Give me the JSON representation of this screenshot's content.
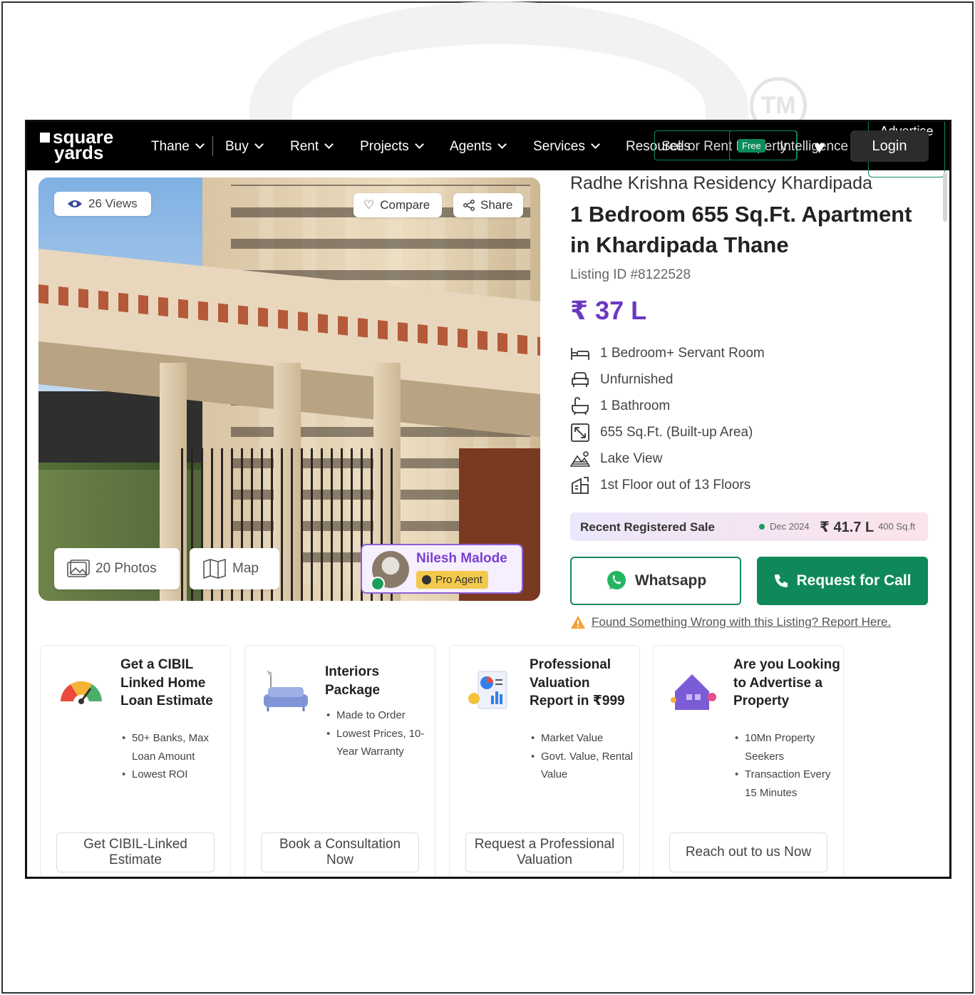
{
  "nav": {
    "logo_line1": "square",
    "logo_line2": "yards",
    "items": [
      {
        "label": "Thane"
      },
      {
        "label": "Buy"
      },
      {
        "label": "Rent"
      },
      {
        "label": "Projects"
      },
      {
        "label": "Agents"
      },
      {
        "label": "Services"
      }
    ],
    "resources_label": "Resources",
    "sell_rent_label": "Sell or Rent Property",
    "free_badge": "Free",
    "intelligence_label": "Intelligence",
    "login_label": "Login",
    "advertise_label": "Advertise with us"
  },
  "gallery": {
    "views": "26 Views",
    "compare_label": "Compare",
    "share_label": "Share",
    "photos_label": "20 Photos",
    "map_label": "Map",
    "agent_name": "Nilesh Malode",
    "agent_badge": "Pro Agent"
  },
  "listing": {
    "project_name": "Radhe Krishna Residency Khardipada",
    "title": "1 Bedroom 655 Sq.Ft. Apartment in Khardipada Thane",
    "listing_id": "Listing ID #8122528",
    "price": "₹ 37 L",
    "features": [
      {
        "icon": "bed-icon",
        "label": "1 Bedroom+ Servant Room"
      },
      {
        "icon": "sofa-icon",
        "label": "Unfurnished"
      },
      {
        "icon": "bathtub-icon",
        "label": "1 Bathroom"
      },
      {
        "icon": "area-icon",
        "label": "655 Sq.Ft. (Built-up Area)"
      },
      {
        "icon": "view-icon",
        "label": "Lake View"
      },
      {
        "icon": "floor-icon",
        "label": "1st Floor out of 13 Floors"
      }
    ],
    "recent_sale": {
      "label": "Recent Registered Sale",
      "date": "Dec 2024",
      "price": "₹ 41.7 L",
      "area": "400 Sq.ft"
    },
    "whatsapp_label": "Whatsapp",
    "call_label": "Request for Call",
    "report_text": "Found Something Wrong with this Listing? Report Here."
  },
  "cards": [
    {
      "icon": "gauge-icon",
      "title": "Get a CIBIL Linked Home Loan Estimate",
      "bullets": [
        "50+ Banks, Max Loan Amount",
        "Lowest ROI"
      ],
      "button": "Get CIBIL-Linked Estimate"
    },
    {
      "icon": "sofa-lamp-icon",
      "title": "Interiors Package",
      "bullets": [
        "Made to Order",
        "Lowest Prices, 10-Year Warranty"
      ],
      "button": "Book a Consultation Now"
    },
    {
      "icon": "report-chart-icon",
      "title": "Professional Valuation Report in ₹999",
      "bullets": [
        "Market Value",
        "Govt. Value, Rental Value"
      ],
      "button": "Request a Professional Valuation"
    },
    {
      "icon": "house-megaphone-icon",
      "title": "Are you Looking to Advertise a Property",
      "bullets": [
        "10Mn Property Seekers",
        "Transaction Every 15 Minutes"
      ],
      "button": "Reach out to us Now"
    }
  ],
  "colors": {
    "price_purple": "#6a38c2",
    "call_green": "#10895a",
    "nav_bg": "#000000"
  }
}
